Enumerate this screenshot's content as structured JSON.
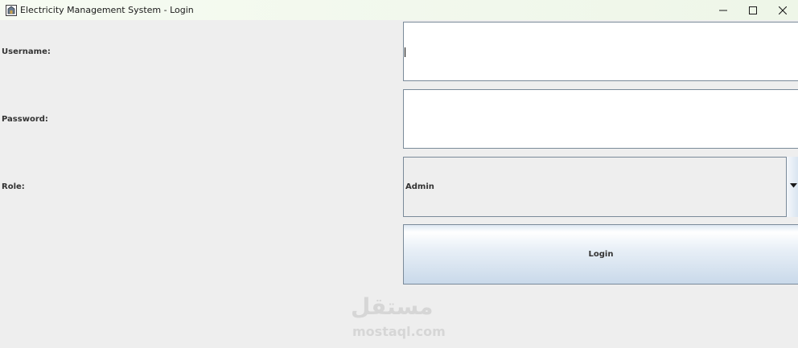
{
  "window": {
    "title": "Electricity Management System - Login",
    "app_icon": "java-app-icon",
    "controls": {
      "minimize_icon": "minimize-icon",
      "maximize_icon": "maximize-icon",
      "close_icon": "close-icon"
    }
  },
  "form": {
    "username_label": "Username:",
    "username_value": "",
    "password_label": "Password:",
    "password_value": "",
    "role_label": "Role:",
    "role_selected": "Admin",
    "role_dropdown_icon": "triangle-down-icon",
    "login_label": "Login"
  },
  "watermark": {
    "arabic": "مستقل",
    "latin": "mostaql.com"
  },
  "colors": {
    "background": "#eeeeee",
    "field_border": "#7a8a99",
    "titlebar": "#f6fbf2"
  }
}
